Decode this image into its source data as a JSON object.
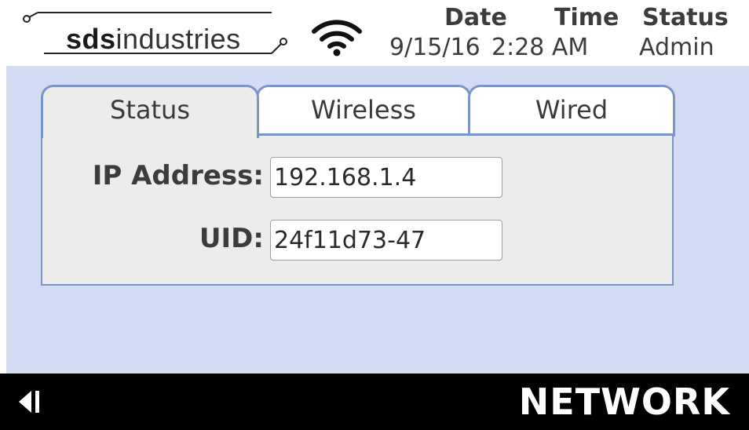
{
  "header": {
    "logo_bold": "sds",
    "logo_light": "industries",
    "date_label": "Date",
    "time_label": "Time",
    "status_label": "Status",
    "date_value": "9/15/16",
    "time_value": "2:28 AM",
    "status_value": "Admin",
    "wifi_icon": "wifi-icon"
  },
  "tabs": [
    {
      "label": "Status",
      "active": true
    },
    {
      "label": "Wireless",
      "active": false
    },
    {
      "label": "Wired",
      "active": false
    }
  ],
  "fields": {
    "ip_label": "IP Address:",
    "ip_value": "192.168.1.4",
    "uid_label": "UID:",
    "uid_value": "24f11d73-47"
  },
  "footer": {
    "title": "NETWORK",
    "back_icon": "back-arrow-icon"
  },
  "colors": {
    "content_bg": "#d4dcf3",
    "panel_bg": "#ececec",
    "tab_border": "#7b95cc",
    "footer_bg": "#000000"
  }
}
